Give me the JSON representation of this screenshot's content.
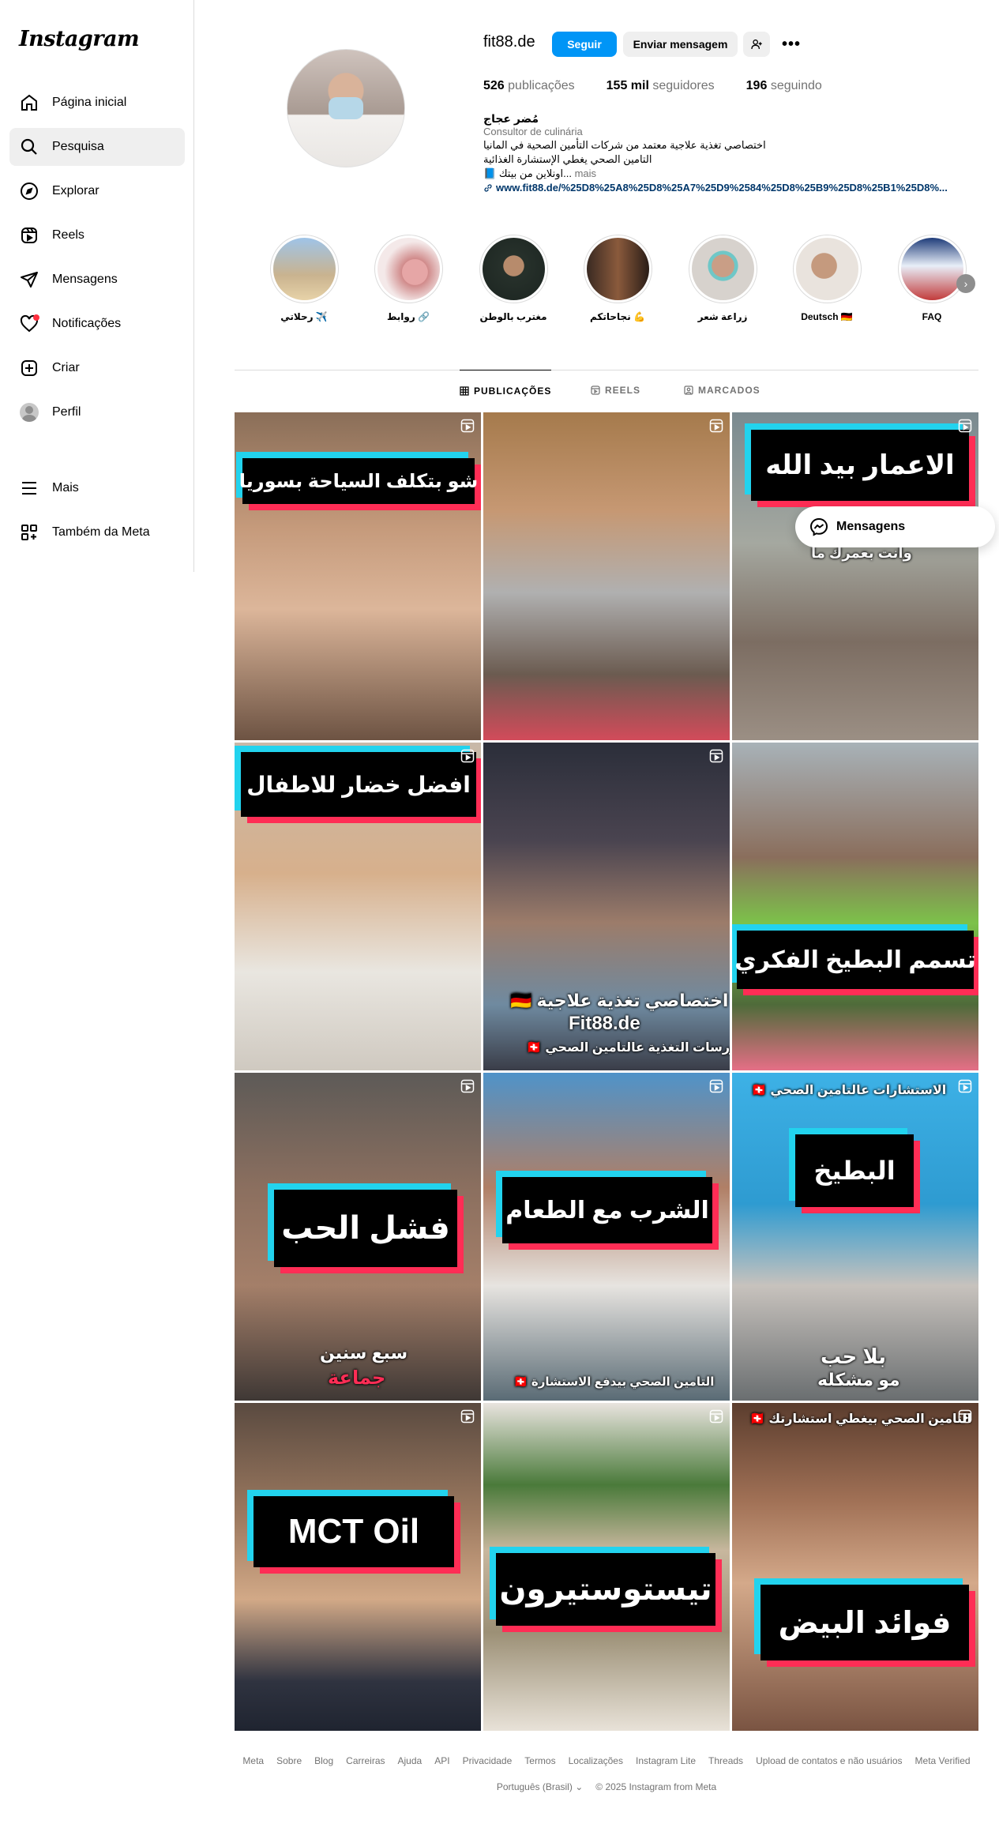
{
  "app": {
    "logo": "Instagram"
  },
  "sidebar": {
    "items": [
      {
        "label": "Página inicial",
        "icon": "home-icon"
      },
      {
        "label": "Pesquisa",
        "icon": "search-icon"
      },
      {
        "label": "Explorar",
        "icon": "compass-icon"
      },
      {
        "label": "Reels",
        "icon": "reels-icon"
      },
      {
        "label": "Mensagens",
        "icon": "send-icon"
      },
      {
        "label": "Notificações",
        "icon": "heart-icon"
      },
      {
        "label": "Criar",
        "icon": "plus-square-icon"
      },
      {
        "label": "Perfil",
        "icon": "avatar"
      }
    ],
    "more": "Mais",
    "meta": "Também da Meta"
  },
  "profile": {
    "username": "fit88.de",
    "follow_label": "Seguir",
    "message_label": "Enviar mensagem",
    "stats": {
      "posts_count": "526",
      "posts_label": "publicações",
      "followers_count": "155 mil",
      "followers_label": "seguidores",
      "following_count": "196",
      "following_label": "seguindo"
    },
    "bio": {
      "name": "مُضر عجاج",
      "category": "Consultor de culinária",
      "line1": "اختصاصي تغذية علاجية معتمد من شركات التأمين الصحية في المانيا",
      "line2": "التامين الصحي يغطي الإستشارة الغذائية",
      "line3": "📘 اونلاين من بيتك...",
      "more": "mais",
      "link": "www.fit88.de/%25D8%25A8%25D8%25A7%25D9%2584%25D8%25B9%25D8%25B1%25D8%..."
    }
  },
  "highlights": [
    {
      "label": "رحلاتي ✈️"
    },
    {
      "label": "روابط 🔗"
    },
    {
      "label": "مغترب بالوطن"
    },
    {
      "label": "نجاحاتكم 💪"
    },
    {
      "label": "زراعة شعر"
    },
    {
      "label": "Deutsch 🇩🇪"
    },
    {
      "label": "FAQ"
    }
  ],
  "tabs": {
    "posts": "PUBLICAÇÕES",
    "reels": "REELS",
    "tagged": "MARCADOS"
  },
  "posts": [
    {
      "caption": "شو بتكلف السياحة بسوريا"
    },
    {
      "caption": ""
    },
    {
      "caption": "الاعمار بيد الله",
      "sub": "وانت بعمرك ما"
    },
    {
      "caption": "افضل خضار للاطفال"
    },
    {
      "caption": "",
      "sub1": "اختصاصي تغذية علاجية 🇩🇪",
      "sub2": "Fit88.de",
      "sub3": "كورسات التغذية عالتامين الصحي 🇨🇭"
    },
    {
      "caption": "تسمم البطيخ الفكري"
    },
    {
      "caption": "فشل الحب",
      "sub1": "سبع سنين",
      "sub2": "جماعة"
    },
    {
      "caption": "الشرب مع الطعام",
      "sub": "التامين الصحي بيدفع الاستشارة 🇨🇭"
    },
    {
      "caption": "البطيخ",
      "top": "الاستشارات عالتامين الصحي 🇨🇭",
      "sub1": "بلا حب",
      "sub2": "مو مشكله"
    },
    {
      "caption": "MCT Oil"
    },
    {
      "caption": "تيستوستيرون"
    },
    {
      "caption": "فوائد البيض",
      "top": "التامين الصحي بيغطي استشارتك 🇨🇭"
    }
  ],
  "floating": {
    "messages_label": "Mensagens"
  },
  "footer": {
    "links": [
      "Meta",
      "Sobre",
      "Blog",
      "Carreiras",
      "Ajuda",
      "API",
      "Privacidade",
      "Termos",
      "Localizações",
      "Instagram Lite",
      "Threads",
      "Upload de contatos e não usuários",
      "Meta Verified"
    ],
    "language": "Português (Brasil)",
    "copyright": "© 2025 Instagram from Meta"
  },
  "colors": {
    "accent": "#0095f6",
    "caption_cyan": "#22d3ee",
    "caption_pink": "#ff2d55",
    "link": "#00376b"
  }
}
